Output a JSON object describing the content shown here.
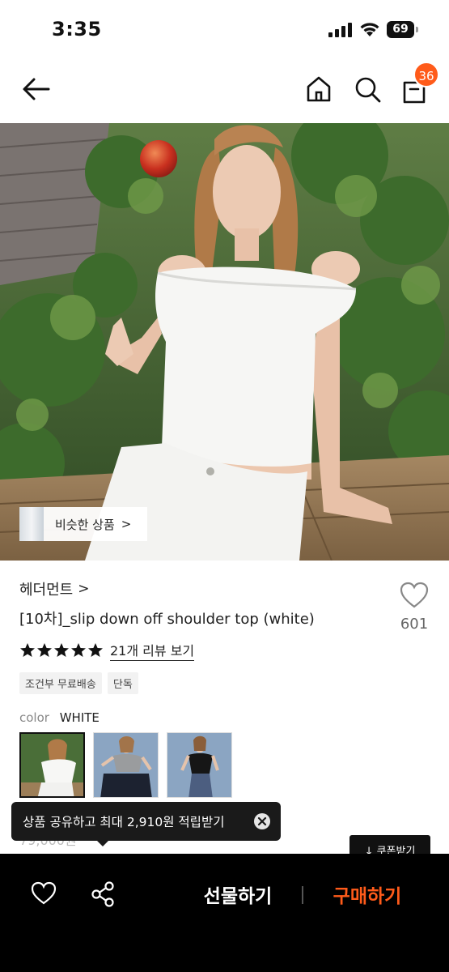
{
  "status_bar": {
    "time": "3:35",
    "battery": "69"
  },
  "nav": {
    "cart_count": "36"
  },
  "hero": {
    "similar_label": "비슷한 상품",
    "similar_chevron": ">"
  },
  "product": {
    "brand": "헤더먼트",
    "brand_chevron": ">",
    "title": "[10차]_slip down off shoulder top (white)",
    "like_count": "601",
    "rating_stars": 5,
    "review_link": "21개 리뷰 보기",
    "tags": [
      "조건부 무료배송",
      "단독"
    ],
    "color_label": "color",
    "color_value": "WHITE",
    "price_peek": "79,000원"
  },
  "toast": {
    "text": "상품 공유하고 최대 2,910원 적립받기"
  },
  "coupon_button": "↓ 쿠폰받기",
  "bottom_bar": {
    "gift_label": "선물하기",
    "buy_label": "구매하기"
  },
  "colors": {
    "accent": "#ff5b1a",
    "dark": "#000000",
    "tag_bg": "#f2f2f2"
  },
  "icons": [
    "back-arrow-icon",
    "home-icon",
    "search-icon",
    "shopping-bag-icon",
    "heart-icon",
    "star-icon",
    "close-icon",
    "share-icon"
  ]
}
